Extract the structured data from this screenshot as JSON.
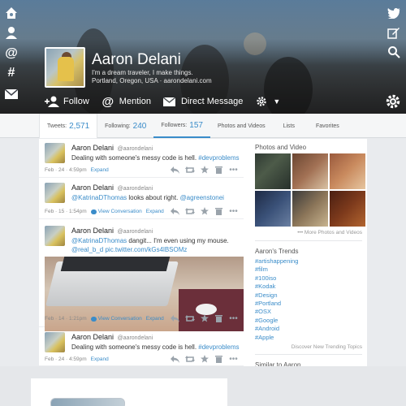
{
  "profile": {
    "name": "Aaron Delani",
    "bio": "I'm a dream traveler, I make things.",
    "location": "Portland, Oregon, USA · aarondelani.com"
  },
  "actions": {
    "follow": "Follow",
    "mention": "Mention",
    "direct_message": "Direct Message"
  },
  "tabs": [
    {
      "label": "Tweets:",
      "count": "2,571"
    },
    {
      "label": "Following:",
      "count": "240"
    },
    {
      "label": "Followers:",
      "count": "157"
    },
    {
      "label": "Photos and Videos"
    },
    {
      "label": "Lists"
    },
    {
      "label": "Favorites"
    }
  ],
  "tweets": [
    {
      "name": "Aaron Delani",
      "handle": "@aarondelani",
      "text": "Dealing with someone's messy code is hell.",
      "tag": "#devproblems",
      "time": "Feb · 24 · 4:59pm",
      "expand": "Expand"
    },
    {
      "name": "Aaron Delani",
      "handle": "@aarondelani",
      "mention": "@KatrinaDThomas",
      "text": "looks about right.",
      "mention2": "@agreenstonei",
      "time": "Feb · 15 · 1:54pm",
      "view_conversation": "View Conversation",
      "expand": "Expand"
    },
    {
      "name": "Aaron Delani",
      "handle": "@aarondelani",
      "mention": "@KatrinaDThomas",
      "text": "dangit... I'm even using my mouse.",
      "link": "@real_b_d pic.twitter.com/kGs4lBSOMz",
      "time": "Feb · 14 · 1:21pm",
      "view_conversation": "View Conversation",
      "expand": "Expand"
    },
    {
      "name": "Aaron Delani",
      "handle": "@aarondelani",
      "text": "Dealing with someone's messy code is hell.",
      "tag": "#devproblems",
      "time": "Feb · 24 · 4:59pm",
      "expand": "Expand"
    }
  ],
  "sidebar": {
    "photos_title": "Photos and Video",
    "more_photos": "More Photos and Videos",
    "trends_title": "Aaron's Trends",
    "trends": [
      "#artishappening",
      "#film",
      "#100iso",
      "#Kodak",
      "#Design",
      "#Portland",
      "#OSX",
      "#Google",
      "#Android",
      "#Apple"
    ],
    "discover": "Discover New Trending Topics",
    "similar_title": "Similar to Aaron"
  },
  "colors": {
    "accent": "#3a8cc9",
    "tab_bar": "#f5f6f7"
  }
}
